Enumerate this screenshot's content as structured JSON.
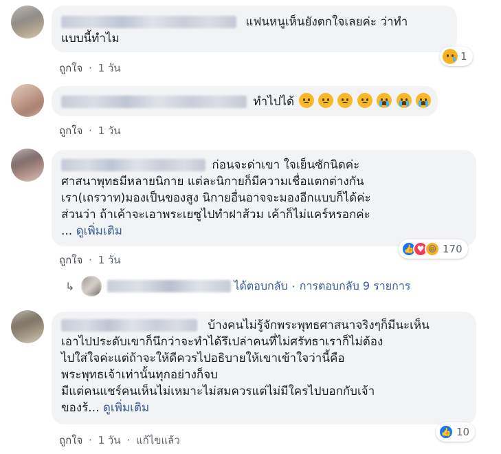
{
  "comments": [
    {
      "lines": [
        "แฟนหนูเห็นยังตกใจเลยค่ะ ว่าทำ",
        "แบบนี้ทำไม"
      ],
      "like_label": "ถูกใจ",
      "time": "1 วัน",
      "reaction_count": "1",
      "reaction_icons": [
        "sad-icon"
      ]
    },
    {
      "lines": [
        "ทำไปได้"
      ],
      "like_label": "ถูกใจ",
      "time": "1 วัน",
      "emoji_icons": [
        "sad-emoji",
        "sad-emoji",
        "sad-emoji",
        "sad-emoji",
        "crying-emoji",
        "crying-emoji",
        "crying-emoji"
      ]
    },
    {
      "lines": [
        "ก่อนจะด่าเขา ใจเย็นซักนิดค่ะ",
        "ศาสนาพุทธมีหลายนิกาย แต่ละนิกายก็มีความเชื่อแตกต่างกัน",
        "เรา(เถรวาท)มองเป็นของสูง นิกายอื่นอาจจะมองอีกแบบก็ได้ค่ะ",
        "ส่วนว่า ถ้าเค้าจะเอาพระเยซูไปทำฝาส้วม เค้าก็ไม่แคร์หรอกค่ะ"
      ],
      "ellipsis": "...",
      "see_more": "ดูเพิ่มเติม",
      "like_label": "ถูกใจ",
      "time": "1 วัน",
      "reaction_count": "170",
      "reaction_icons": [
        "like-icon",
        "love-icon",
        "haha-icon"
      ],
      "reply_action": "ได้ตอบกลับ",
      "reply_count_text": "การตอบกลับ 9 รายการ"
    },
    {
      "lines": [
        "บ้างคนไม่รู้จักพระพุทธศาสนาจริงๆก็มีนะเห็น",
        "เอาไปประดับเขาก็นึกว่าจะทำได้รึเปล่าคนที่ไม่ศรัทธาเราก็ไม่ต้อง",
        "ไปใส่ใจค่ะแต่ถ้าจะให้ดีควรไปอธิบายให้เขาเข้าใจว่านี้คือ",
        "พระพุทธเจ้าเท่านั้นทุกอย่างก็จบ",
        "มีแต่คนแชร์คนเห็นไม่เหมาะไม่สมควรแต่ไม่มีใครไปบอกกับเจ้า",
        "ของร้..."
      ],
      "see_more": "ดูเพิ่มเติม",
      "like_label": "ถูกใจ",
      "time": "1 วัน",
      "edited": "แก้ไขแล้ว",
      "reaction_count": "10",
      "reaction_icons": [
        "like-icon"
      ]
    }
  ],
  "separator": "·",
  "colors": {
    "bubble": "#f2f3f5",
    "link": "#385898",
    "meta": "#616770",
    "like_blue": "#1877f2",
    "love_red": "#f33e58",
    "emoji_yellow": "#f7b928"
  }
}
